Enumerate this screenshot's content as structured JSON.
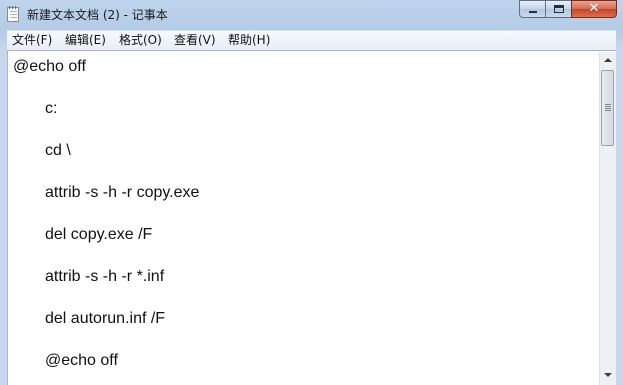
{
  "window": {
    "title": "新建文本文档 (2) - 记事本",
    "close_glyph": "✕"
  },
  "menu": {
    "items": [
      {
        "label": "文件(F)"
      },
      {
        "label": "编辑(E)"
      },
      {
        "label": "格式(O)"
      },
      {
        "label": "查看(V)"
      },
      {
        "label": "帮助(H)"
      }
    ]
  },
  "editor": {
    "lines": [
      "@echo off",
      "c:",
      "cd \\",
      "attrib -s -h -r copy.exe",
      "del copy.exe /F",
      "attrib -s -h -r *.inf",
      "del autorun.inf /F",
      "@echo off"
    ]
  },
  "icons": {
    "app": "notepad-icon",
    "minimize": "minimize-icon",
    "maximize": "maximize-icon",
    "close": "close-icon",
    "scroll_up": "scroll-up-arrow-icon",
    "scroll_down": "scroll-down-arrow-icon"
  },
  "colors": {
    "frame": "#bfd4ec",
    "close_button": "#c3432a",
    "text": "#111111"
  }
}
